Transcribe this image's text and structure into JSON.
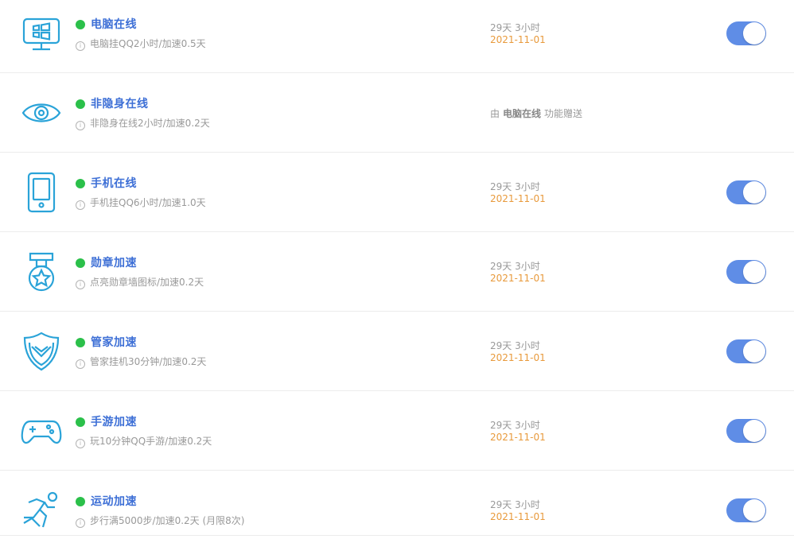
{
  "colors": {
    "accent": "#3d6fd6",
    "online_dot": "#2bc04a",
    "date": "#e89a3c",
    "toggle_on": "#5f8de6"
  },
  "items": [
    {
      "icon": "computer-icon",
      "title": "电脑在线",
      "desc": "电脑挂QQ2小时/加速0.5天",
      "time": "29天 3小时",
      "date": "2021-11-01",
      "enabled": true
    },
    {
      "icon": "eye-icon",
      "title": "非隐身在线",
      "desc": "非隐身在线2小时/加速0.2天",
      "gift_prefix": "由",
      "gift_source": "电脑在线",
      "gift_suffix": "功能赠送"
    },
    {
      "icon": "phone-icon",
      "title": "手机在线",
      "desc": "手机挂QQ6小时/加速1.0天",
      "time": "29天 3小时",
      "date": "2021-11-01",
      "enabled": true
    },
    {
      "icon": "medal-icon",
      "title": "勋章加速",
      "desc": "点亮勋章墙图标/加速0.2天",
      "time": "29天 3小时",
      "date": "2021-11-01",
      "enabled": true
    },
    {
      "icon": "shield-icon",
      "title": "管家加速",
      "desc": "管家挂机30分钟/加速0.2天",
      "time": "29天 3小时",
      "date": "2021-11-01",
      "enabled": true
    },
    {
      "icon": "gamepad-icon",
      "title": "手游加速",
      "desc": "玩10分钟QQ手游/加速0.2天",
      "time": "29天 3小时",
      "date": "2021-11-01",
      "enabled": true
    },
    {
      "icon": "running-icon",
      "title": "运动加速",
      "desc": "步行满5000步/加速0.2天 (月限8次)",
      "time": "29天 3小时",
      "date": "2021-11-01",
      "enabled": true
    }
  ]
}
